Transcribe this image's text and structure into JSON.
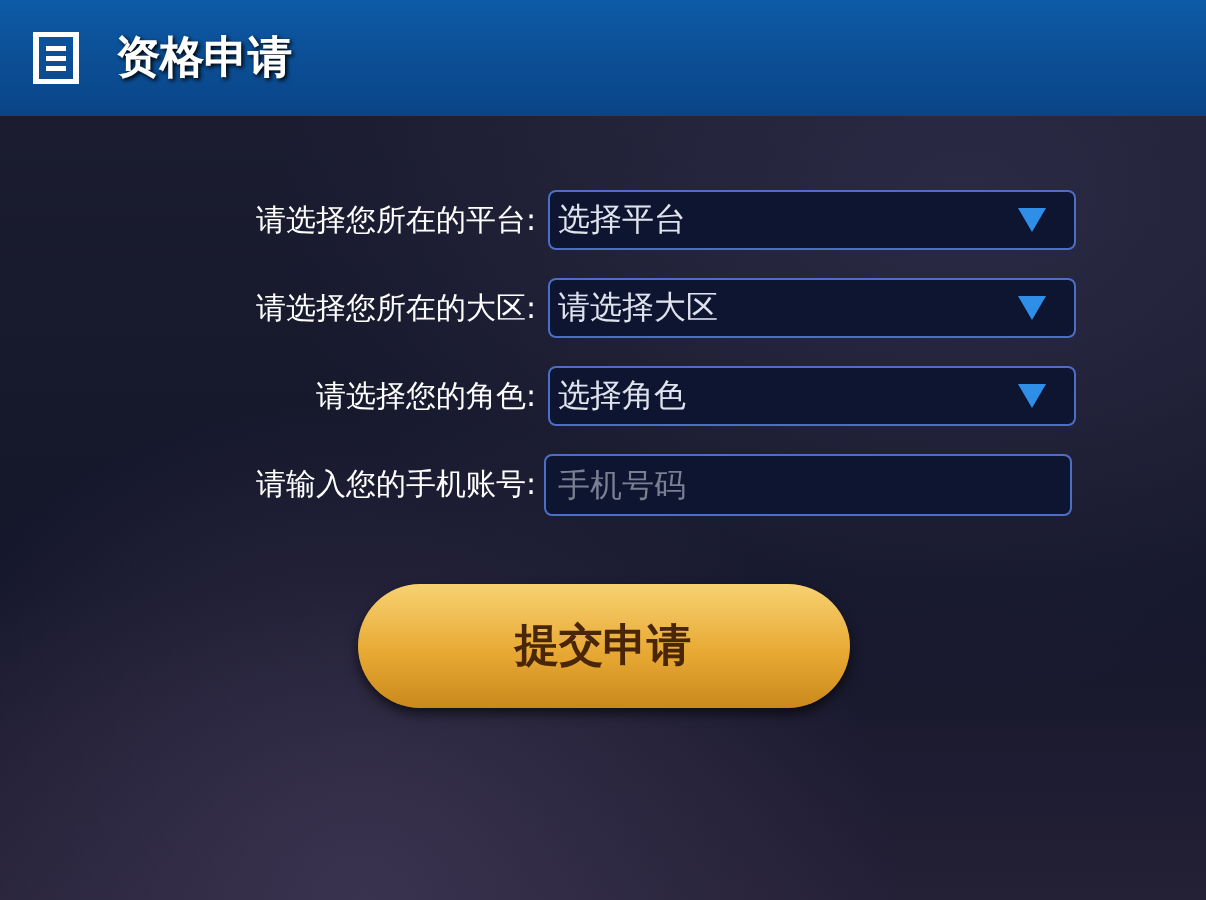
{
  "header": {
    "title": "资格申请"
  },
  "fields": [
    {
      "label": "请选择您所在的平台:",
      "kind": "select",
      "value": "选择平台"
    },
    {
      "label": "请选择您所在的大区:",
      "kind": "select",
      "value": "请选择大区"
    },
    {
      "label": "请选择您的角色:",
      "kind": "select",
      "value": "选择角色"
    },
    {
      "label": "请输入您的手机账号:",
      "kind": "input",
      "placeholder": "手机号码"
    }
  ],
  "submit": {
    "label": "提交申请"
  }
}
